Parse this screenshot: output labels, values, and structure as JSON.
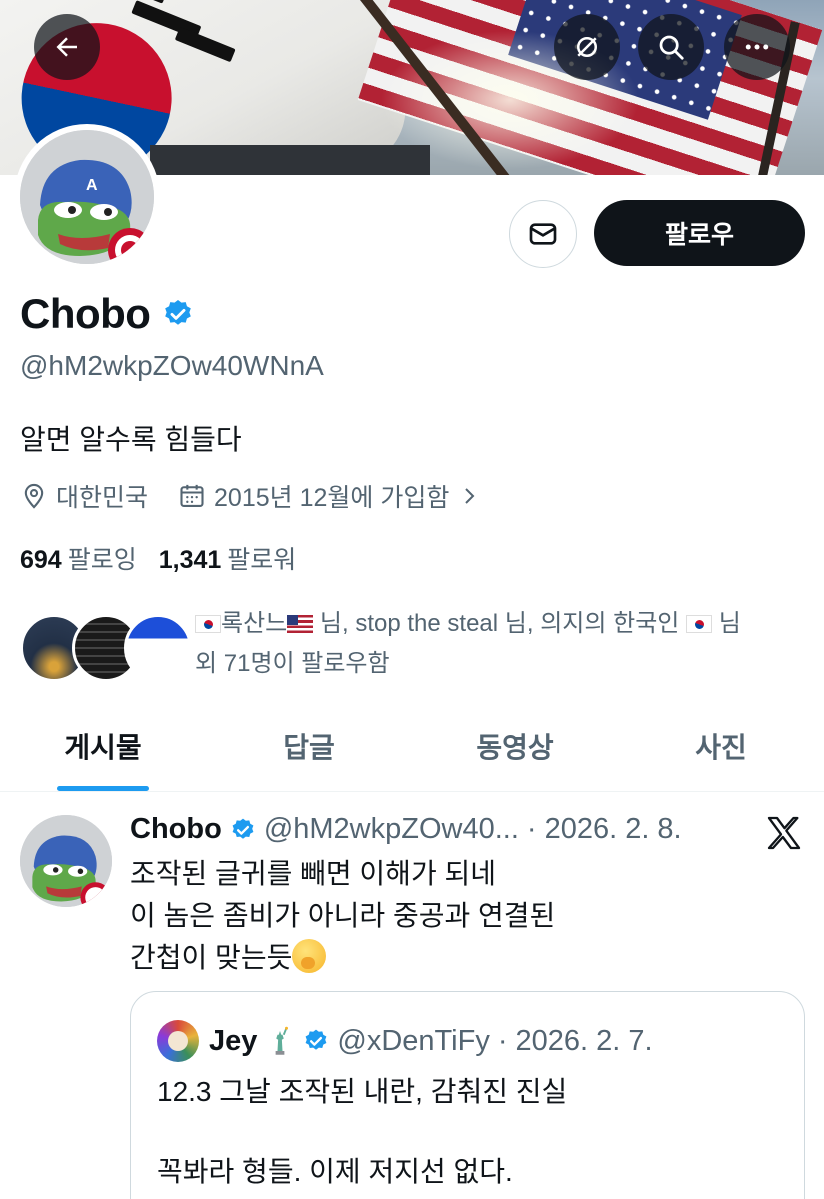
{
  "header": {
    "back_icon": "arrow-left-icon",
    "action_icons": [
      "link-off-icon",
      "search-icon",
      "more-icon"
    ]
  },
  "profile": {
    "display_name": "Chobo",
    "handle": "@hM2wkpZOw40WNnA",
    "bio": "알면 알수록 힘들다",
    "location": "대한민국",
    "joined": "2015년 12월에 가입함",
    "follow_label": "팔로우",
    "following_count": "694",
    "following_label": "팔로잉",
    "followers_count": "1,341",
    "followers_label": "팔로워",
    "verified_color": "#1d9bf0"
  },
  "known_followers": {
    "name1": "록산느",
    "sep1": " 님, ",
    "name2": "stop the steal",
    "sep2": " 님, ",
    "name3": "의지의 한국인 ",
    "sep3": " 님",
    "line2": "외 71명이 팔로우함"
  },
  "tabs": [
    {
      "label": "게시물",
      "active": true
    },
    {
      "label": "답글",
      "active": false
    },
    {
      "label": "동영상",
      "active": false
    },
    {
      "label": "사진",
      "active": false
    }
  ],
  "post": {
    "name": "Chobo",
    "handle": "@hM2wkpZOw40...",
    "dot": "·",
    "date": "2026. 2. 8.",
    "line1": "조작된 글귀를 빼면 이해가 되네",
    "line2": "이 놈은 좀비가 아니라 중공과 연결된",
    "line3": "간첩이 맞는듯",
    "quote": {
      "name": "Jey",
      "handle": "@xDenTiFy",
      "dot": "·",
      "date": "2026. 2. 7.",
      "body": "12.3 그날 조작된 내란, 감춰진 진실\n\n꼭봐라 형들. 이제 저지선 없다."
    }
  }
}
